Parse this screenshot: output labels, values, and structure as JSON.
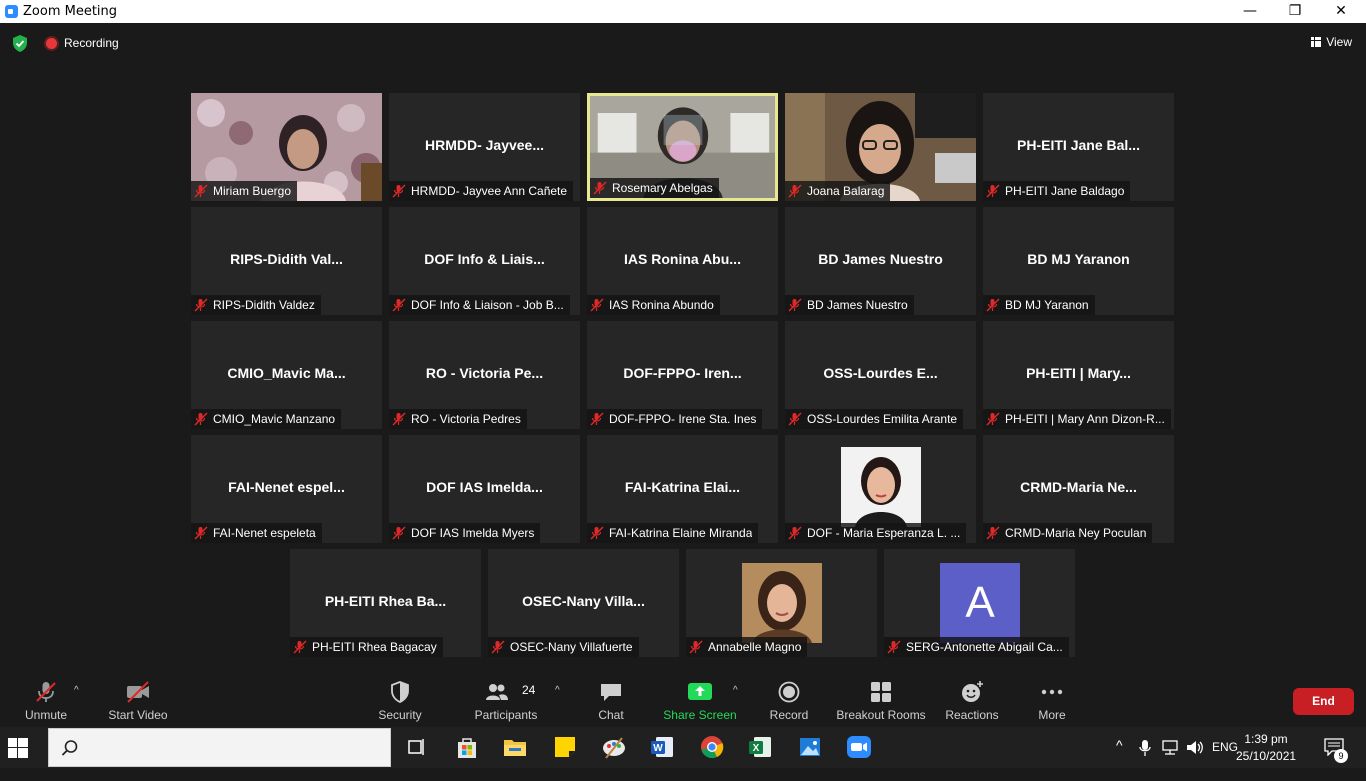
{
  "window": {
    "title": "Zoom Meeting",
    "minimize_glyph": "—",
    "restore_glyph": "❐",
    "close_glyph": "✕"
  },
  "topbar": {
    "security_icon": "shield-check-icon",
    "recording_label": "Recording",
    "view_label": "View"
  },
  "participants": [
    {
      "big": "",
      "label": "Miriam Buergo",
      "video": "miriam-video"
    },
    {
      "big": "HRMDD-  Jayvee...",
      "label": "HRMDD- Jayvee Ann Cañete"
    },
    {
      "big": "",
      "label": "Rosemary Abelgas",
      "video": "rosemary-video",
      "active": true
    },
    {
      "big": "",
      "label": "Joana Balarag",
      "video": "joana-video"
    },
    {
      "big": "PH-EITI Jane Bal...",
      "label": "PH-EITI Jane Baldago"
    },
    {
      "big": "RIPS-Didith  Val...",
      "label": "RIPS-Didith Valdez"
    },
    {
      "big": "DOF Info & Liais...",
      "label": "DOF Info & Liaison - Job B..."
    },
    {
      "big": "IAS Ronina Abu...",
      "label": "IAS Ronina Abundo"
    },
    {
      "big": "BD James Nuestro",
      "label": "BD James Nuestro"
    },
    {
      "big": "BD MJ Yaranon",
      "label": "BD MJ Yaranon"
    },
    {
      "big": "CMIO_Mavic  Ma...",
      "label": "CMIO_Mavic Manzano"
    },
    {
      "big": "RO  - Victoria Pe...",
      "label": "RO - Victoria Pedres"
    },
    {
      "big": "DOF-FPPO-  Iren...",
      "label": "DOF-FPPO- Irene Sta. Ines"
    },
    {
      "big": "OSS-Lourdes  E...",
      "label": "OSS-Lourdes Emilita Arante"
    },
    {
      "big": "PH-EITI | Mary...",
      "label": "PH-EITI | Mary Ann Dizon-R..."
    },
    {
      "big": "FAI-Nenet  espel...",
      "label": "FAI-Nenet espeleta"
    },
    {
      "big": "DOF IAS Imelda...",
      "label": "DOF IAS Imelda Myers"
    },
    {
      "big": "FAI-Katrina  Elai...",
      "label": "FAI-Katrina Elaine Miranda"
    },
    {
      "big": "",
      "label": "DOF - Maria Esperanza L. ...",
      "video": "maria-photo"
    },
    {
      "big": "CRMD-Maria  Ne...",
      "label": "CRMD-Maria Ney Poculan"
    },
    {
      "big": "PH-EITI Rhea Ba...",
      "label": "PH-EITI Rhea Bagacay"
    },
    {
      "big": "OSEC-Nany  Villa...",
      "label": "OSEC-Nany Villafuerte"
    },
    {
      "big": "",
      "label": "Annabelle Magno",
      "video": "annabelle-photo"
    },
    {
      "big": "",
      "label": "SERG-Antonette Abigail Ca...",
      "avatar_letter": "A",
      "avatar_color": "#5b5fc7"
    }
  ],
  "toolbar": {
    "unmute": "Unmute",
    "start_video": "Start Video",
    "security": "Security",
    "participants": "Participants",
    "participants_count": "24",
    "chat": "Chat",
    "share_screen": "Share Screen",
    "record": "Record",
    "breakout_rooms": "Breakout Rooms",
    "reactions": "Reactions",
    "more": "More",
    "end": "End",
    "caret": "^",
    "share_color": "#23d959",
    "end_color": "#c81f25"
  },
  "taskbar": {
    "search_placeholder": "",
    "apps": [
      "task-view-icon",
      "microsoft-store-icon",
      "file-explorer-icon",
      "sticky-notes-icon",
      "paint-icon",
      "word-icon",
      "chrome-icon",
      "excel-icon",
      "photos-icon",
      "zoom-icon"
    ],
    "tray": {
      "language": "ENG",
      "time": "1:39 pm",
      "date": "25/10/2021",
      "notification_count": "9",
      "chevron": "^"
    }
  }
}
